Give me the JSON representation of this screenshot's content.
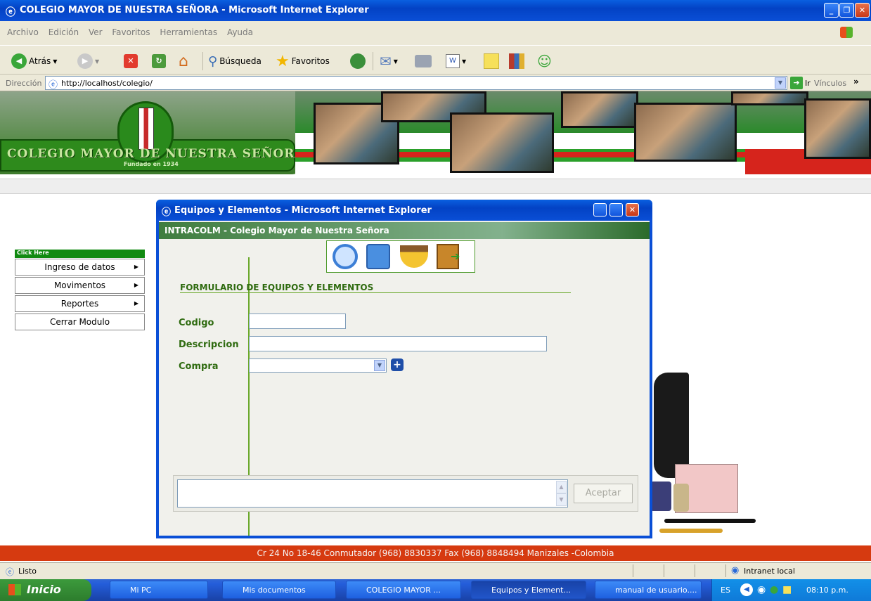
{
  "window": {
    "title": "COLEGIO MAYOR DE NUESTRA SEÑORA - Microsoft Internet Explorer"
  },
  "menubar": [
    "Archivo",
    "Edición",
    "Ver",
    "Favoritos",
    "Herramientas",
    "Ayuda"
  ],
  "toolbar": {
    "back_label": "Atrás",
    "search_label": "Búsqueda",
    "favorites_label": "Favoritos"
  },
  "address": {
    "label": "Dirección",
    "url": "http://localhost/colegio/",
    "go_label": "Ir",
    "links_label": "Vínculos"
  },
  "banner": {
    "school_name": "COLEGIO MAYOR DE NUESTRA SEÑORA",
    "founded": "Fundado en 1934"
  },
  "side_menu": {
    "header": "Click Here",
    "items": [
      "Ingreso de datos",
      "Movimentos",
      "Reportes",
      "Cerrar Modulo"
    ]
  },
  "popup": {
    "title": "Equipos y Elementos - Microsoft Internet Explorer",
    "app_header": "INTRACOLM - Colegio Mayor de Nuestra Señora",
    "form_title": "FORMULARIO DE EQUIPOS Y ELEMENTOS",
    "fields": {
      "codigo": "Codigo",
      "descripcion": "Descripcion",
      "compra": "Compra"
    },
    "accept_label": "Aceptar"
  },
  "footer": {
    "text": "Cr 24 No 18-46 Conmutador (968) 8830337 Fax (968) 8848494 Manizales -Colombia"
  },
  "status": {
    "text": "Listo",
    "zone": "Intranet local"
  },
  "taskbar": {
    "start_label": "Inicio",
    "items": [
      "Mi PC",
      "Mis documentos",
      "COLEGIO MAYOR ...",
      "Equipos y Element...",
      "manual de usuario...."
    ],
    "lang": "ES",
    "clock": "08:10 p.m."
  }
}
